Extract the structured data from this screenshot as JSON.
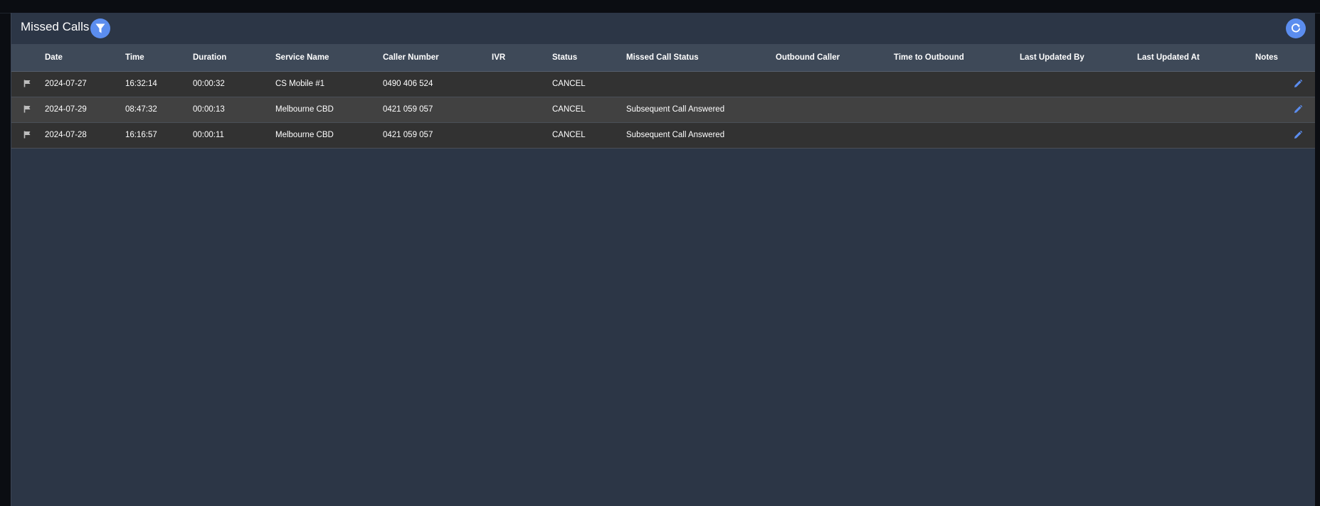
{
  "panel": {
    "title": "Missed Calls"
  },
  "icons": {
    "filter": "filter-icon",
    "refresh": "refresh-icon",
    "flag": "flag-icon",
    "edit": "pencil-icon"
  },
  "colors": {
    "accent": "#5b8def",
    "panel_bg": "#2c3646",
    "header_bg": "#3e4958",
    "row_odd": "#323232",
    "row_even": "#414141",
    "edit_icon": "#5b8def"
  },
  "table": {
    "columns": [
      "",
      "Date",
      "Time",
      "Duration",
      "Service Name",
      "Caller Number",
      "IVR",
      "Status",
      "Missed Call Status",
      "Outbound Caller",
      "Time to Outbound",
      "Last Updated By",
      "Last Updated At",
      "Notes"
    ],
    "rows": [
      {
        "date": "2024-07-27",
        "time": "16:32:14",
        "duration": "00:00:32",
        "service_name": "CS Mobile #1",
        "caller_number": "0490 406 524",
        "ivr": "",
        "status": "CANCEL",
        "missed_call_status": "",
        "outbound_caller": "",
        "time_to_outbound": "",
        "last_updated_by": "",
        "last_updated_at": ""
      },
      {
        "date": "2024-07-29",
        "time": "08:47:32",
        "duration": "00:00:13",
        "service_name": "Melbourne CBD",
        "caller_number": "0421 059 057",
        "ivr": "",
        "status": "CANCEL",
        "missed_call_status": "Subsequent Call Answered",
        "outbound_caller": "",
        "time_to_outbound": "",
        "last_updated_by": "",
        "last_updated_at": ""
      },
      {
        "date": "2024-07-28",
        "time": "16:16:57",
        "duration": "00:00:11",
        "service_name": "Melbourne CBD",
        "caller_number": "0421 059 057",
        "ivr": "",
        "status": "CANCEL",
        "missed_call_status": "Subsequent Call Answered",
        "outbound_caller": "",
        "time_to_outbound": "",
        "last_updated_by": "",
        "last_updated_at": ""
      }
    ]
  }
}
